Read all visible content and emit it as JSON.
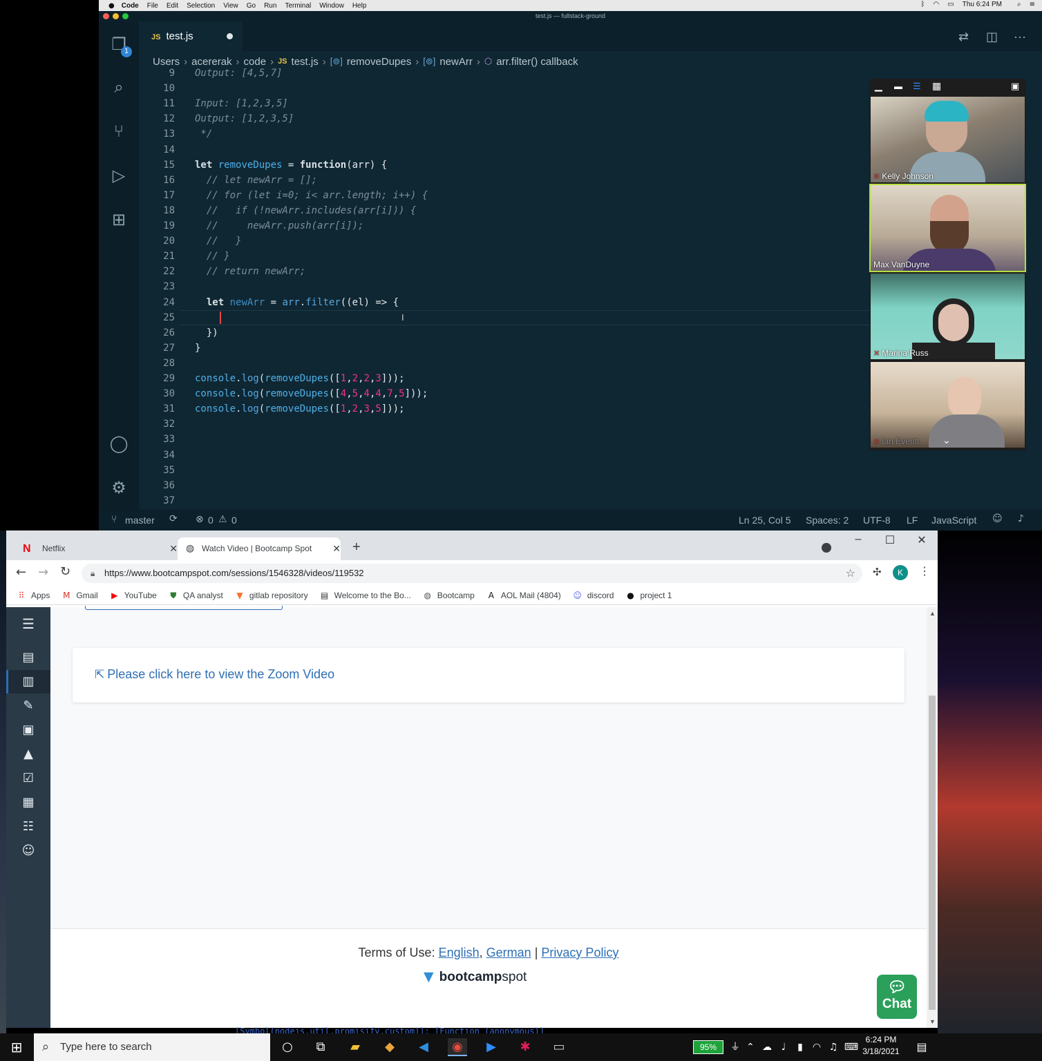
{
  "mac_menu": {
    "app": "Code",
    "items": [
      "File",
      "Edit",
      "Selection",
      "View",
      "Go",
      "Run",
      "Terminal",
      "Window",
      "Help"
    ],
    "clock": "Thu 6:24 PM"
  },
  "vscode": {
    "window_title": "test.js — fullstack-ground",
    "tab_label": "test.js",
    "tab_lang_badge": "JS",
    "explorer_badge": "1",
    "breadcrumbs": [
      "Users",
      "acererak",
      "code",
      "test.js",
      "removeDupes",
      "newArr",
      "arr.filter() callback"
    ],
    "line_numbers": [
      "9",
      "10",
      "11",
      "12",
      "13",
      "14",
      "15",
      "16",
      "17",
      "18",
      "19",
      "20",
      "21",
      "22",
      "23",
      "24",
      "25",
      "26",
      "27",
      "28",
      "29",
      "30",
      "31",
      "32",
      "33",
      "34",
      "35",
      "36",
      "37"
    ],
    "code_lines": [
      "Output: [4,5,7]",
      "",
      "Input: [1,2,3,5]",
      "Output: [1,2,3,5]",
      " */",
      "",
      "let removeDupes = function(arr) {",
      "  // let newArr = [];",
      "  // for (let i=0; i< arr.length; i++) {",
      "  //   if (!newArr.includes(arr[i])) {",
      "  //     newArr.push(arr[i]);",
      "  //   }",
      "  // }",
      "  // return newArr;",
      "",
      "  let newArr = arr.filter((el) => {",
      "",
      "  })",
      "}",
      "",
      "console.log(removeDupes([1,2,2,3]));",
      "console.log(removeDupes([4,5,4,4,7,5]));",
      "console.log(removeDupes([1,2,3,5]));",
      "",
      "",
      "",
      "",
      "",
      ""
    ],
    "status": {
      "branch": "master",
      "errors": "0",
      "warnings": "0",
      "position": "Ln 25, Col 5",
      "spaces": "Spaces: 2",
      "encoding": "UTF-8",
      "eol": "LF",
      "language": "JavaScript"
    }
  },
  "zoom": {
    "participants": [
      {
        "name": "Kelly Johnson",
        "muted": true
      },
      {
        "name": "Max VanDuyne",
        "muted": false
      },
      {
        "name": "Marina Russ",
        "muted": true
      },
      {
        "name": "Ian Everitt",
        "muted": true
      }
    ]
  },
  "chrome": {
    "tabs": [
      {
        "label": "Netflix",
        "favicon": "netflix-icon"
      },
      {
        "label": "Watch Video | Bootcamp Spot",
        "favicon": "globe-icon"
      }
    ],
    "url": "https://www.bootcampspot.com/sessions/1546328/videos/119532",
    "profile_initial": "K",
    "bookmarks": [
      {
        "label": "Apps",
        "icon": "apps-grid-icon",
        "color": "#e94235"
      },
      {
        "label": "Gmail",
        "icon": "gmail-icon",
        "color": "#d93025"
      },
      {
        "label": "YouTube",
        "icon": "youtube-icon",
        "color": "#ff0000"
      },
      {
        "label": "QA analyst",
        "icon": "shield-icon",
        "color": "#2d7d2d"
      },
      {
        "label": "gitlab repository",
        "icon": "gitlab-icon",
        "color": "#fc6d26"
      },
      {
        "label": "Welcome to the Bo...",
        "icon": "book-icon",
        "color": "#333333"
      },
      {
        "label": "Bootcamp",
        "icon": "globe-icon",
        "color": "#555555"
      },
      {
        "label": "AOL Mail (4804)",
        "icon": "aol-icon",
        "color": "#111111"
      },
      {
        "label": "discord",
        "icon": "discord-icon",
        "color": "#5865f2"
      },
      {
        "label": "project 1",
        "icon": "github-icon",
        "color": "#111111"
      }
    ]
  },
  "page": {
    "zoom_link": "Please click here to view the Zoom Video",
    "terms_prefix": "Terms of Use:",
    "terms_english": "English",
    "terms_german": "German",
    "privacy": "Privacy Policy",
    "logo_bold": "bootcamp",
    "logo_light": "spot",
    "chat_label": "Chat"
  },
  "taskbar": {
    "search_placeholder": "Type here to search",
    "battery": "95%",
    "time": "6:24 PM",
    "date": "3/18/2021"
  },
  "background_terminal_text": "[Symbol(nodejs.util.promisify.custom)]: [Function (anonymous)]"
}
